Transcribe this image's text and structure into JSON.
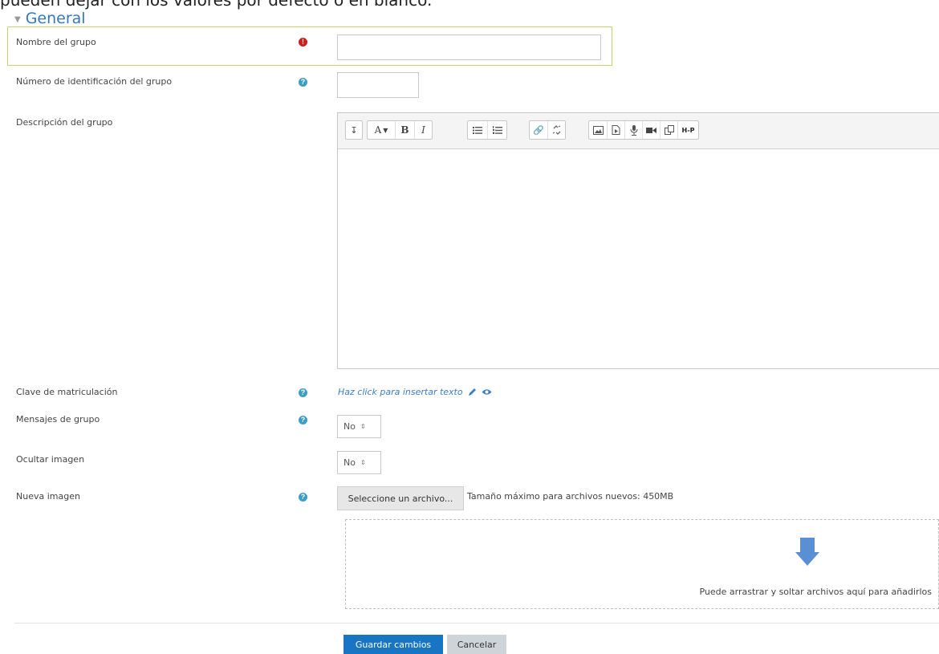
{
  "intro_text": "pueden dejar con los valores por defecto o en blanco.",
  "section": {
    "title": "General"
  },
  "fields": {
    "group_name": {
      "label": "Nombre del grupo",
      "value": "",
      "placeholder": ""
    },
    "group_id": {
      "label": "Número de identificación del grupo",
      "value": ""
    },
    "description": {
      "label": "Descripción del grupo"
    },
    "enrolment_key": {
      "label": "Clave de matriculación",
      "link_text": "Haz click para insertar texto"
    },
    "group_messaging": {
      "label": "Mensajes de grupo",
      "selected": "No"
    },
    "hide_picture": {
      "label": "Ocultar imagen",
      "selected": "No"
    },
    "new_picture": {
      "label": "Nueva imagen",
      "choose_button": "Seleccione un archivo...",
      "max_size_text": "Tamaño máximo para archivos nuevos: 450MB",
      "drop_hint": "Puede arrastrar y soltar archivos aquí para añadirlos"
    }
  },
  "toolbar": {
    "buttons": [
      "collapse",
      "font-color",
      "bold",
      "italic",
      "unordered-list",
      "ordered-list",
      "link",
      "unlink",
      "image",
      "media",
      "record-audio",
      "record-video",
      "manage-files",
      "h5p"
    ],
    "bold_label": "B",
    "italic_label": "I",
    "font_label": "A",
    "h5p_label": "H-P"
  },
  "actions": {
    "save": "Guardar cambios",
    "cancel": "Cancelar"
  },
  "colors": {
    "accent": "#3577c4",
    "primary_button": "#1775c3",
    "required": "#cc1f1f",
    "help": "#3c9ec4",
    "highlight": "#c3d86c"
  }
}
